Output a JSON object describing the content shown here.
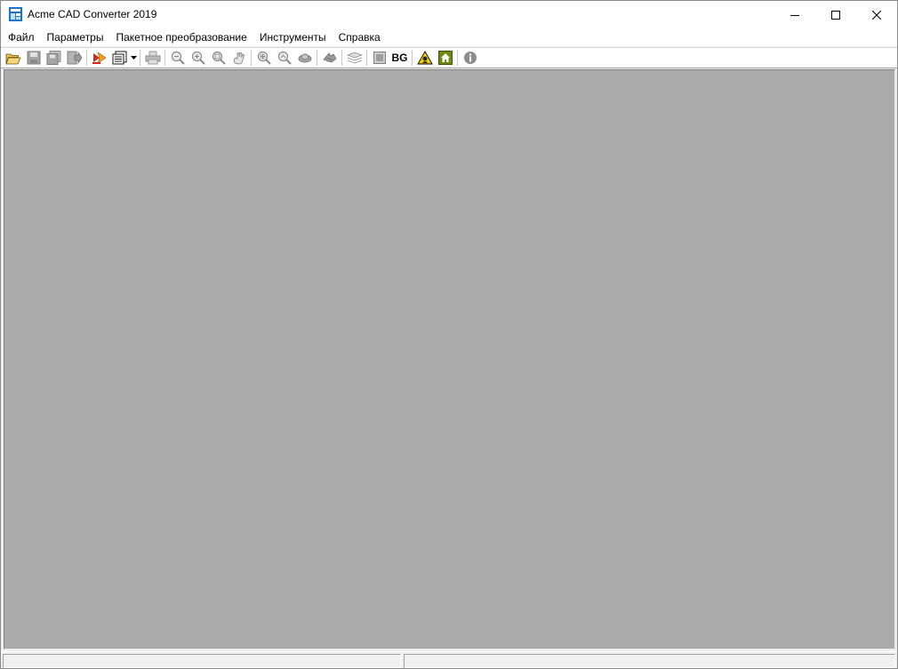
{
  "window": {
    "title": "Acme CAD Converter 2019"
  },
  "menu": {
    "items": [
      {
        "label": "Файл"
      },
      {
        "label": "Параметры"
      },
      {
        "label": "Пакетное преобразование"
      },
      {
        "label": "Инструменты"
      },
      {
        "label": "Справка"
      }
    ]
  },
  "toolbar": {
    "bg_label": "BG",
    "icons": [
      "open-folder-icon",
      "save-icon",
      "save-as-icon",
      "export-icon",
      "convert-icon",
      "batch-icon",
      "print-icon",
      "zoom-out-icon",
      "zoom-in-icon",
      "zoom-window-icon",
      "pan-icon",
      "zoom-extents-icon",
      "zoom-realtime-icon",
      "view-icon",
      "layers-icon",
      "properties-icon",
      "background-icon",
      "warning-icon",
      "home-icon",
      "info-icon"
    ]
  },
  "colors": {
    "workarea": "#ababab",
    "chrome": "#f0f0f0",
    "accent": "#1e72c8"
  }
}
